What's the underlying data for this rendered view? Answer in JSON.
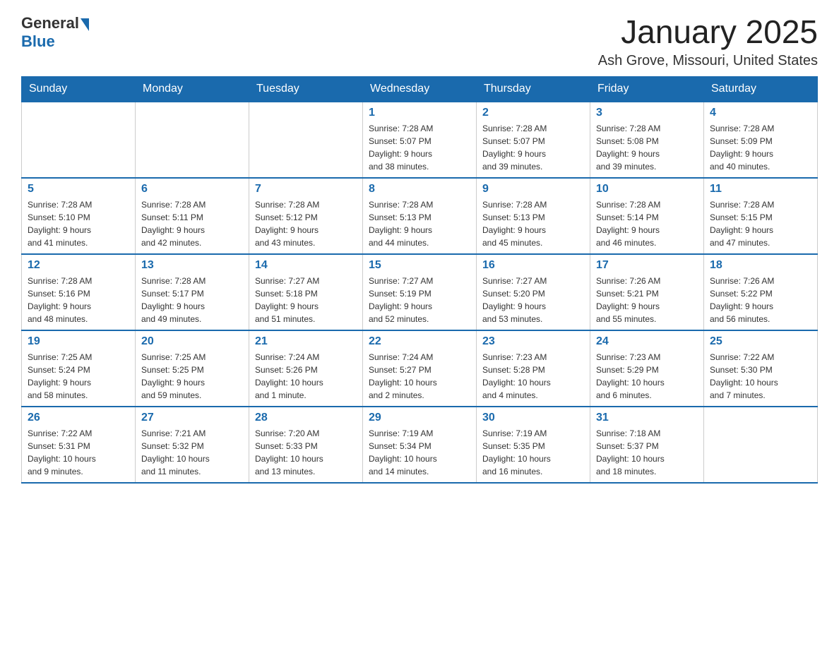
{
  "header": {
    "logo_general": "General",
    "logo_blue": "Blue",
    "month_title": "January 2025",
    "location": "Ash Grove, Missouri, United States"
  },
  "weekdays": [
    "Sunday",
    "Monday",
    "Tuesday",
    "Wednesday",
    "Thursday",
    "Friday",
    "Saturday"
  ],
  "weeks": [
    [
      {
        "day": "",
        "info": ""
      },
      {
        "day": "",
        "info": ""
      },
      {
        "day": "",
        "info": ""
      },
      {
        "day": "1",
        "info": "Sunrise: 7:28 AM\nSunset: 5:07 PM\nDaylight: 9 hours\nand 38 minutes."
      },
      {
        "day": "2",
        "info": "Sunrise: 7:28 AM\nSunset: 5:07 PM\nDaylight: 9 hours\nand 39 minutes."
      },
      {
        "day": "3",
        "info": "Sunrise: 7:28 AM\nSunset: 5:08 PM\nDaylight: 9 hours\nand 39 minutes."
      },
      {
        "day": "4",
        "info": "Sunrise: 7:28 AM\nSunset: 5:09 PM\nDaylight: 9 hours\nand 40 minutes."
      }
    ],
    [
      {
        "day": "5",
        "info": "Sunrise: 7:28 AM\nSunset: 5:10 PM\nDaylight: 9 hours\nand 41 minutes."
      },
      {
        "day": "6",
        "info": "Sunrise: 7:28 AM\nSunset: 5:11 PM\nDaylight: 9 hours\nand 42 minutes."
      },
      {
        "day": "7",
        "info": "Sunrise: 7:28 AM\nSunset: 5:12 PM\nDaylight: 9 hours\nand 43 minutes."
      },
      {
        "day": "8",
        "info": "Sunrise: 7:28 AM\nSunset: 5:13 PM\nDaylight: 9 hours\nand 44 minutes."
      },
      {
        "day": "9",
        "info": "Sunrise: 7:28 AM\nSunset: 5:13 PM\nDaylight: 9 hours\nand 45 minutes."
      },
      {
        "day": "10",
        "info": "Sunrise: 7:28 AM\nSunset: 5:14 PM\nDaylight: 9 hours\nand 46 minutes."
      },
      {
        "day": "11",
        "info": "Sunrise: 7:28 AM\nSunset: 5:15 PM\nDaylight: 9 hours\nand 47 minutes."
      }
    ],
    [
      {
        "day": "12",
        "info": "Sunrise: 7:28 AM\nSunset: 5:16 PM\nDaylight: 9 hours\nand 48 minutes."
      },
      {
        "day": "13",
        "info": "Sunrise: 7:28 AM\nSunset: 5:17 PM\nDaylight: 9 hours\nand 49 minutes."
      },
      {
        "day": "14",
        "info": "Sunrise: 7:27 AM\nSunset: 5:18 PM\nDaylight: 9 hours\nand 51 minutes."
      },
      {
        "day": "15",
        "info": "Sunrise: 7:27 AM\nSunset: 5:19 PM\nDaylight: 9 hours\nand 52 minutes."
      },
      {
        "day": "16",
        "info": "Sunrise: 7:27 AM\nSunset: 5:20 PM\nDaylight: 9 hours\nand 53 minutes."
      },
      {
        "day": "17",
        "info": "Sunrise: 7:26 AM\nSunset: 5:21 PM\nDaylight: 9 hours\nand 55 minutes."
      },
      {
        "day": "18",
        "info": "Sunrise: 7:26 AM\nSunset: 5:22 PM\nDaylight: 9 hours\nand 56 minutes."
      }
    ],
    [
      {
        "day": "19",
        "info": "Sunrise: 7:25 AM\nSunset: 5:24 PM\nDaylight: 9 hours\nand 58 minutes."
      },
      {
        "day": "20",
        "info": "Sunrise: 7:25 AM\nSunset: 5:25 PM\nDaylight: 9 hours\nand 59 minutes."
      },
      {
        "day": "21",
        "info": "Sunrise: 7:24 AM\nSunset: 5:26 PM\nDaylight: 10 hours\nand 1 minute."
      },
      {
        "day": "22",
        "info": "Sunrise: 7:24 AM\nSunset: 5:27 PM\nDaylight: 10 hours\nand 2 minutes."
      },
      {
        "day": "23",
        "info": "Sunrise: 7:23 AM\nSunset: 5:28 PM\nDaylight: 10 hours\nand 4 minutes."
      },
      {
        "day": "24",
        "info": "Sunrise: 7:23 AM\nSunset: 5:29 PM\nDaylight: 10 hours\nand 6 minutes."
      },
      {
        "day": "25",
        "info": "Sunrise: 7:22 AM\nSunset: 5:30 PM\nDaylight: 10 hours\nand 7 minutes."
      }
    ],
    [
      {
        "day": "26",
        "info": "Sunrise: 7:22 AM\nSunset: 5:31 PM\nDaylight: 10 hours\nand 9 minutes."
      },
      {
        "day": "27",
        "info": "Sunrise: 7:21 AM\nSunset: 5:32 PM\nDaylight: 10 hours\nand 11 minutes."
      },
      {
        "day": "28",
        "info": "Sunrise: 7:20 AM\nSunset: 5:33 PM\nDaylight: 10 hours\nand 13 minutes."
      },
      {
        "day": "29",
        "info": "Sunrise: 7:19 AM\nSunset: 5:34 PM\nDaylight: 10 hours\nand 14 minutes."
      },
      {
        "day": "30",
        "info": "Sunrise: 7:19 AM\nSunset: 5:35 PM\nDaylight: 10 hours\nand 16 minutes."
      },
      {
        "day": "31",
        "info": "Sunrise: 7:18 AM\nSunset: 5:37 PM\nDaylight: 10 hours\nand 18 minutes."
      },
      {
        "day": "",
        "info": ""
      }
    ]
  ]
}
